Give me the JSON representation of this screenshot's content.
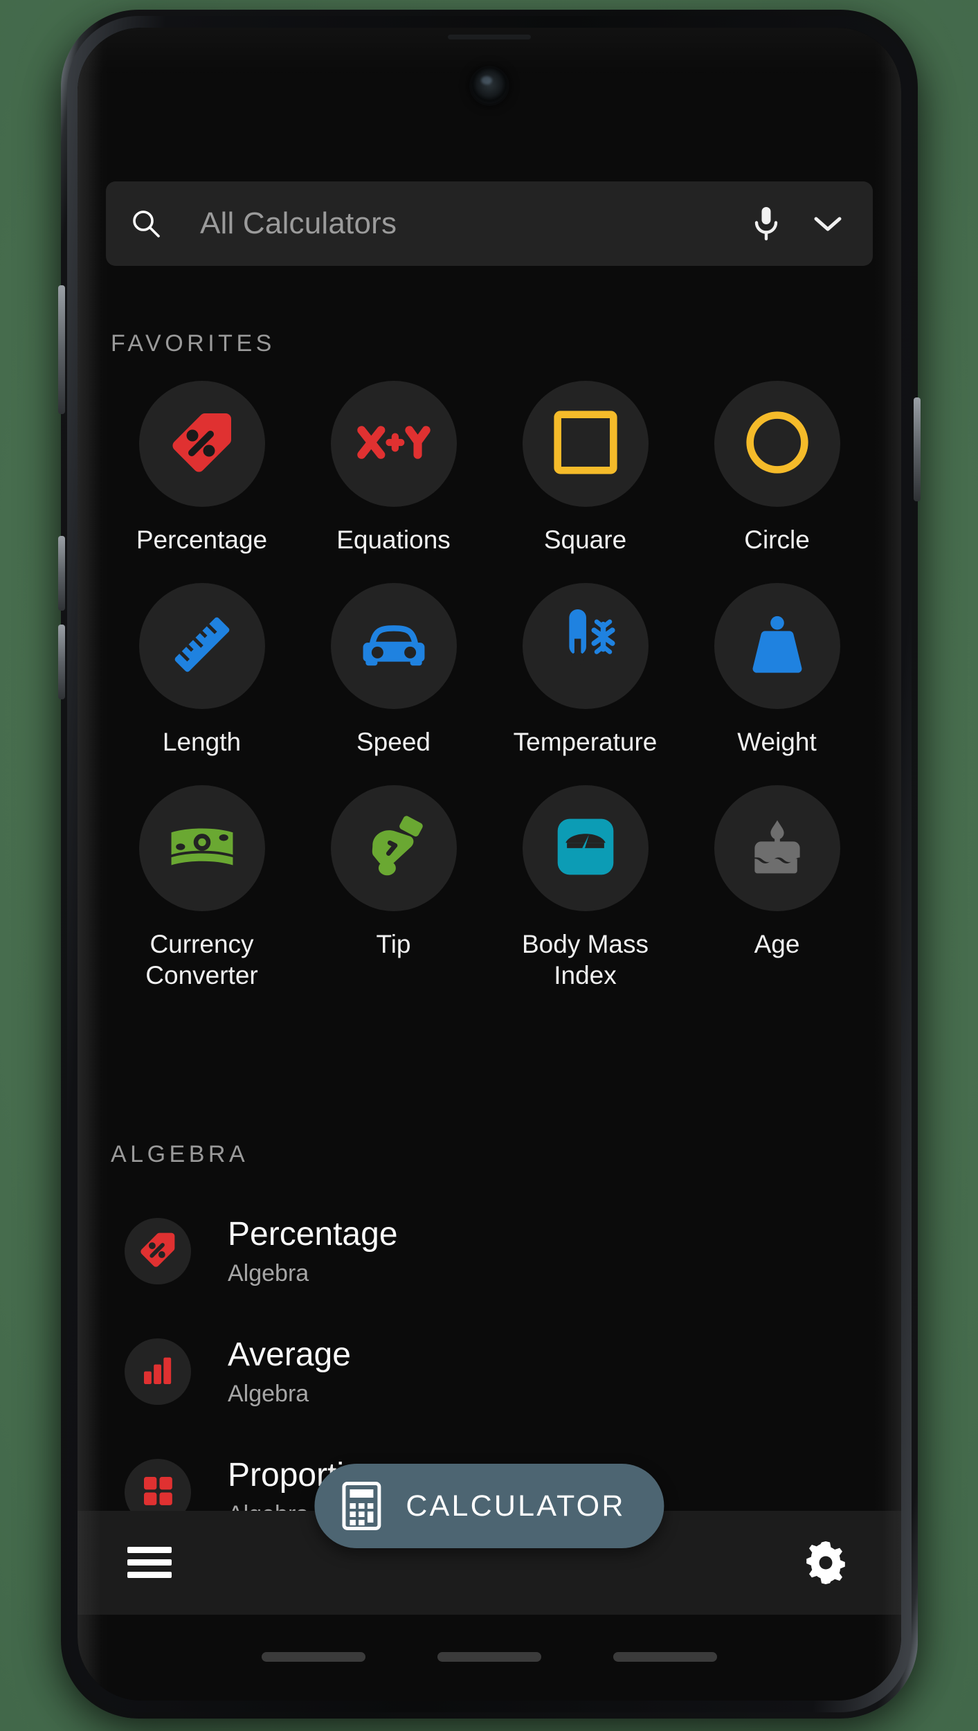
{
  "app": {
    "colors": {
      "background": "#0b0b0b",
      "tile": "#232323",
      "red": "#e03131",
      "amber": "#f5bb2a",
      "blue": "#1f82e0",
      "green": "#6aa832",
      "teal": "#0c9cb5",
      "gray": "#6e6e6e",
      "fab": "#4d6572",
      "bar": "#1c1c1c"
    }
  },
  "search": {
    "placeholder": "All Calculators",
    "search_icon": "search-icon",
    "mic_icon": "microphone-icon",
    "expand_icon": "chevron-down-icon"
  },
  "sections": {
    "favorites_header": "FAVORITES",
    "algebra_header": "ALGEBRA"
  },
  "favorites": [
    {
      "label": "Percentage",
      "icon": "percent-tag-icon",
      "color": "#e03131"
    },
    {
      "label": "Equations",
      "icon": "x-plus-y-icon",
      "color": "#e03131"
    },
    {
      "label": "Square",
      "icon": "square-icon",
      "color": "#f5bb2a"
    },
    {
      "label": "Circle",
      "icon": "circle-icon",
      "color": "#f5bb2a"
    },
    {
      "label": "Length",
      "icon": "ruler-icon",
      "color": "#1f82e0"
    },
    {
      "label": "Speed",
      "icon": "car-icon",
      "color": "#1f82e0"
    },
    {
      "label": "Temperature",
      "icon": "thermometer-snowflake-icon",
      "color": "#1f82e0"
    },
    {
      "label": "Weight",
      "icon": "weight-icon",
      "color": "#1f82e0"
    },
    {
      "label": "Currency\nConverter",
      "icon": "banknote-icon",
      "color": "#6aa832"
    },
    {
      "label": "Tip",
      "icon": "hand-coin-icon",
      "color": "#6aa832"
    },
    {
      "label": "Body Mass\nIndex",
      "icon": "bathroom-scale-icon",
      "color": "#0c9cb5"
    },
    {
      "label": "Age",
      "icon": "birthday-cake-icon",
      "color": "#6e6e6e"
    }
  ],
  "algebra_list": [
    {
      "title": "Percentage",
      "subtitle": "Algebra",
      "icon": "percent-tag-icon",
      "color": "#e03131"
    },
    {
      "title": "Average",
      "subtitle": "Algebra",
      "icon": "bar-chart-icon",
      "color": "#e03131"
    },
    {
      "title": "Proportion",
      "subtitle": "Algebra",
      "icon": "grid-four-icon",
      "color": "#e03131"
    }
  ],
  "fab": {
    "label": "CALCULATOR",
    "icon": "calculator-icon"
  },
  "bottom_bar": {
    "menu_icon": "hamburger-menu-icon",
    "settings_icon": "gear-icon"
  }
}
